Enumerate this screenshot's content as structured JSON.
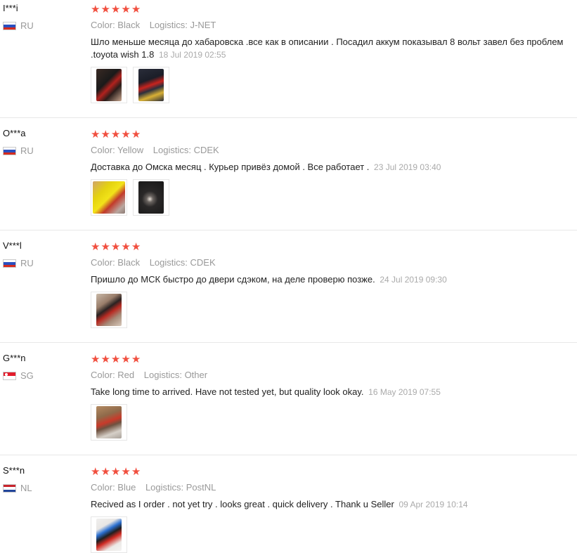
{
  "reviews": [
    {
      "user": "I***i",
      "country_code": "RU",
      "flag": "russia-flag",
      "rating": 5,
      "color_label": "Color: Black",
      "logistics_label": "Logistics: J-NET",
      "text": "Шло меньше месяца до хабаровска .все как в описании . Посадил аккум показывал 8 вольт завел без проблем .toyota wish 1.8",
      "date": "18 Jul 2019 02:55",
      "photos": [
        "photo-1",
        "photo-2"
      ]
    },
    {
      "user": "O***a",
      "country_code": "RU",
      "flag": "russia-flag",
      "rating": 5,
      "color_label": "Color: Yellow",
      "logistics_label": "Logistics: CDEK",
      "text": "Доставка до Омска месяц . Курьер привёз домой . Все работает .",
      "date": "23 Jul 2019 03:40",
      "photos": [
        "photo-1",
        "photo-2"
      ]
    },
    {
      "user": "V***l",
      "country_code": "RU",
      "flag": "russia-flag",
      "rating": 5,
      "color_label": "Color: Black",
      "logistics_label": "Logistics: CDEK",
      "text": "Пришло до МСК быстро до двери сдэком, на деле проверю позже.",
      "date": "24 Jul 2019 09:30",
      "photos": [
        "photo-1"
      ]
    },
    {
      "user": "G***n",
      "country_code": "SG",
      "flag": "singapore-flag",
      "rating": 5,
      "color_label": "Color: Red",
      "logistics_label": "Logistics: Other",
      "text": "Take long time to arrived. Have not tested yet, but quality look okay.",
      "date": "16 May 2019 07:55",
      "photos": [
        "photo-1"
      ]
    },
    {
      "user": "S***n",
      "country_code": "NL",
      "flag": "netherlands-flag",
      "rating": 5,
      "color_label": "Color: Blue",
      "logistics_label": "Logistics: PostNL",
      "text": "Recived as I order . not yet try . looks great . quick delivery . Thank u Seller",
      "date": "09 Apr 2019 10:14",
      "photos": [
        "photo-1"
      ]
    }
  ],
  "colors": {
    "star": "#f14f3f",
    "muted_text": "#999999",
    "body_text": "#222222",
    "divider": "#e8e8e8"
  }
}
